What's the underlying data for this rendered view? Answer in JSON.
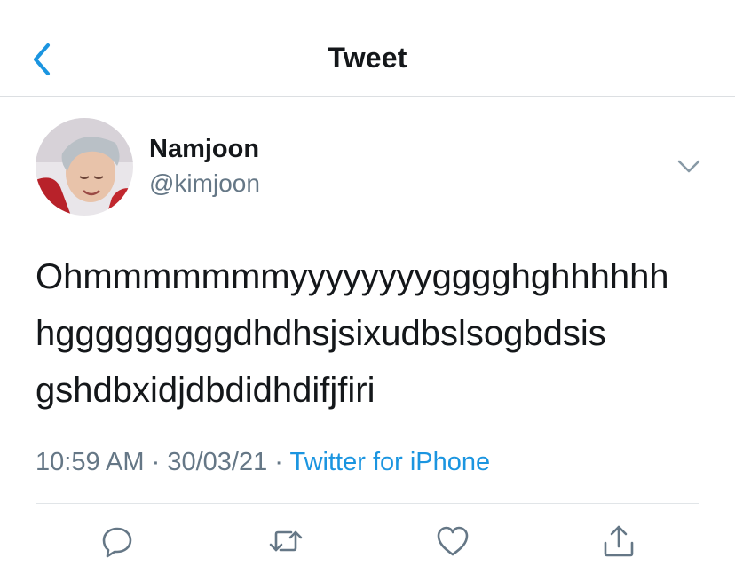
{
  "header": {
    "title": "Tweet",
    "back_icon": "chevron-left-icon"
  },
  "tweet": {
    "author": {
      "name": "Namjoon",
      "handle": "@kimjoon"
    },
    "text_lines": [
      "Ohmmmmmmmyyyyyyyygggghghhhhhh",
      "hgggggggggdhdhsjsixudbslsogbdsis",
      "gshdbxidjdbdidhdifjfiri"
    ],
    "time": "10:59 AM",
    "date": "30/03/21",
    "separator": "·",
    "source": "Twitter for iPhone"
  },
  "actions": [
    "reply-icon",
    "retweet-icon",
    "like-icon",
    "share-icon"
  ],
  "colors": {
    "accent": "#1b95e0",
    "text": "#14171a",
    "muted": "#657786",
    "divider": "#e1e5e8"
  }
}
